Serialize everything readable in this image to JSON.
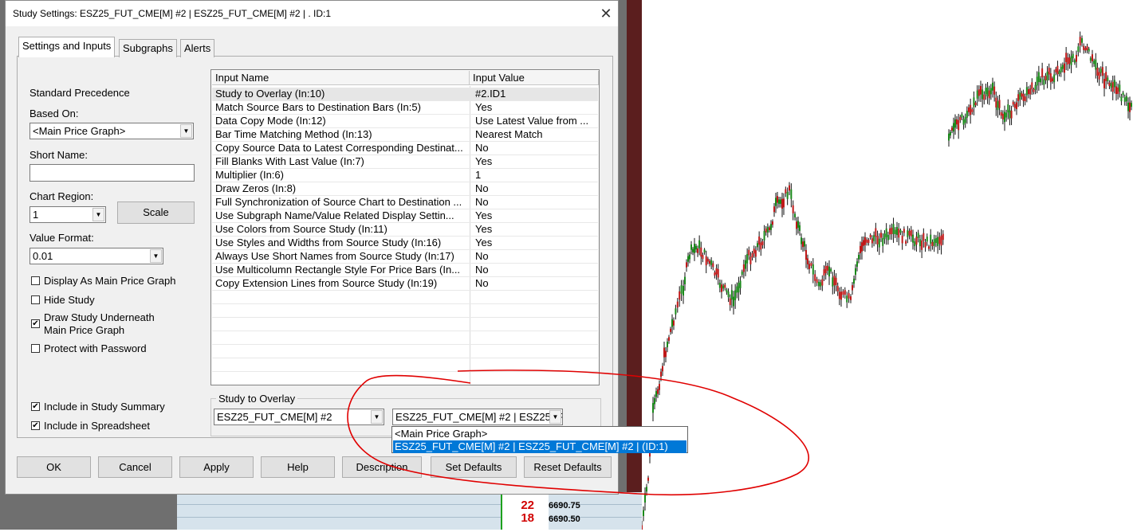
{
  "dialog": {
    "title": "Study Settings: ESZ25_FUT_CME[M] #2 | ESZ25_FUT_CME[M] #2 | . ID:1",
    "close_glyph": "✕",
    "tabs": [
      "Settings and Inputs",
      "Subgraphs",
      "Alerts"
    ]
  },
  "left_panel": {
    "standard_precedence": "Standard Precedence",
    "based_on_label": "Based On:",
    "based_on_value": "<Main Price Graph>",
    "short_name_label": "Short Name:",
    "short_name_value": "",
    "chart_region_label": "Chart Region:",
    "chart_region_value": "1",
    "scale_button": "Scale",
    "value_format_label": "Value Format:",
    "value_format_value": "0.01",
    "checkboxes": [
      {
        "label": "Display As Main Price Graph",
        "checked": false
      },
      {
        "label": "Hide Study",
        "checked": false
      },
      {
        "label": "Draw Study Underneath",
        "label2": "Main Price Graph",
        "checked": true
      },
      {
        "label": "Protect with Password",
        "checked": false
      },
      {
        "label": "Include in Study Summary",
        "checked": true
      },
      {
        "label": "Include in Spreadsheet",
        "checked": true
      }
    ],
    "check_glyph": "✔"
  },
  "inputs_table": {
    "headers": [
      "Input Name",
      "Input Value"
    ],
    "rows": [
      {
        "name": "Study to Overlay  (In:10)",
        "value": "#2.ID1"
      },
      {
        "name": "Match Source Bars to Destination Bars  (In:5)",
        "value": "Yes"
      },
      {
        "name": "Data Copy Mode  (In:12)",
        "value": "Use Latest Value from ..."
      },
      {
        "name": "Bar Time Matching Method  (In:13)",
        "value": "Nearest Match"
      },
      {
        "name": "Copy Source Data to Latest Corresponding Destinat...",
        "value": "No"
      },
      {
        "name": "Fill Blanks With Last Value  (In:7)",
        "value": "Yes"
      },
      {
        "name": "Multiplier  (In:6)",
        "value": "1"
      },
      {
        "name": "Draw Zeros  (In:8)",
        "value": "No"
      },
      {
        "name": "Full Synchronization of Source Chart to Destination  ...",
        "value": "No"
      },
      {
        "name": "Use Subgraph Name/Value Related Display Settin...",
        "value": "Yes"
      },
      {
        "name": "Use Colors from Source Study  (In:11)",
        "value": "Yes"
      },
      {
        "name": "Use Styles and Widths from Source Study  (In:16)",
        "value": "Yes"
      },
      {
        "name": "Always Use Short Names from Source Study  (In:17)",
        "value": "No"
      },
      {
        "name": "Use Multicolumn Rectangle Style For Price Bars  (In...",
        "value": "No"
      },
      {
        "name": "Copy Extension Lines from Source Study  (In:19)",
        "value": "No"
      }
    ]
  },
  "study_overlay": {
    "group_title": "Study to Overlay",
    "chart_select": "ESZ25_FUT_CME[M] #2",
    "study_select": "ESZ25_FUT_CME[M] #2 | ESZ25_FUT_CME[M] #2 | . ID:1",
    "dropdown_options": [
      "<Main Price Graph>",
      "ESZ25_FUT_CME[M] #2 | ESZ25_FUT_CME[M] #2 |  (ID:1)"
    ],
    "selected_option_index": 1
  },
  "buttons": [
    "OK",
    "Cancel",
    "Apply",
    "Help",
    "Description",
    "Set Defaults",
    "Reset Defaults"
  ],
  "background": {
    "dom_rows": [
      {
        "qty": "22",
        "price": "6690.75"
      },
      {
        "qty": "18",
        "price": "6690.50"
      }
    ]
  },
  "colors": {
    "annotation_red": "#e00000",
    "selection_blue": "#0078d7",
    "candle_green": "#1a8a1a",
    "candle_red": "#c01818"
  }
}
